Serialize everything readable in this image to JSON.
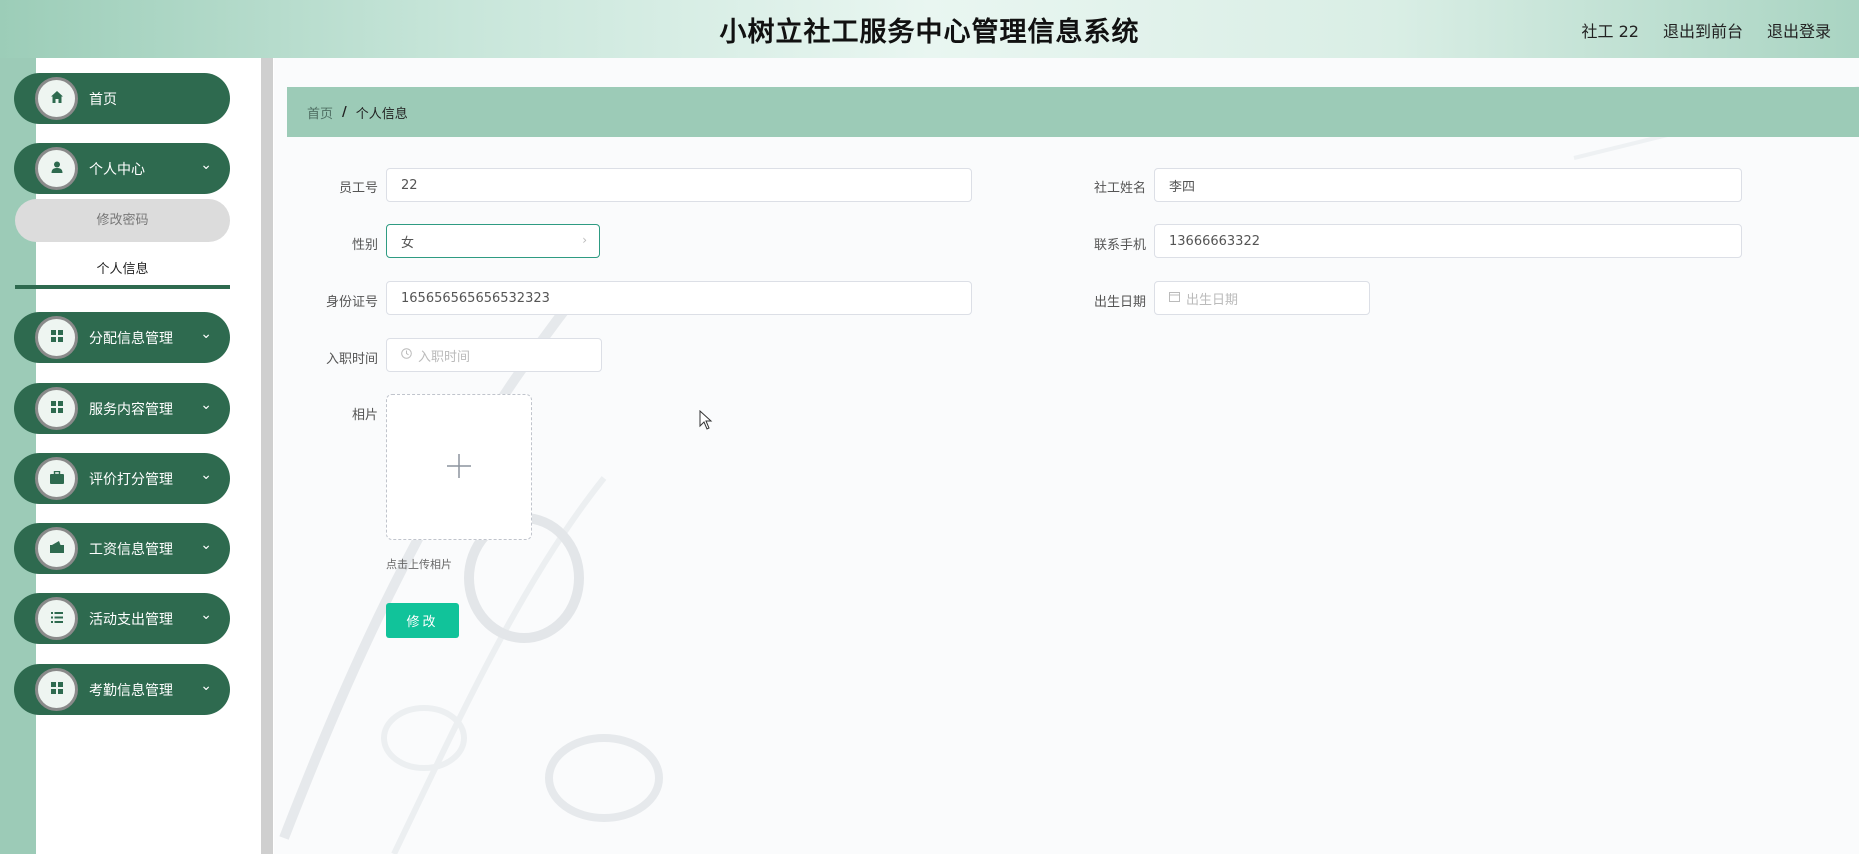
{
  "header": {
    "title": "小树立社工服务中心管理信息系统",
    "user_label": "社工 22",
    "to_front_label": "退出到前台",
    "logout_label": "退出登录"
  },
  "sidebar": {
    "items": [
      {
        "label": "首页",
        "icon": "home-icon",
        "has_children": false
      },
      {
        "label": "个人中心",
        "icon": "user-icon",
        "has_children": true,
        "expanded": true,
        "children": [
          {
            "label": "修改密码",
            "active": false
          },
          {
            "label": "个人信息",
            "active": true
          }
        ]
      },
      {
        "label": "分配信息管理",
        "icon": "grid-icon",
        "has_children": true
      },
      {
        "label": "服务内容管理",
        "icon": "grid-icon",
        "has_children": true
      },
      {
        "label": "评价打分管理",
        "icon": "briefcase-icon",
        "has_children": true
      },
      {
        "label": "工资信息管理",
        "icon": "wallet-icon",
        "has_children": true
      },
      {
        "label": "活动支出管理",
        "icon": "list-icon",
        "has_children": true
      },
      {
        "label": "考勤信息管理",
        "icon": "grid-icon",
        "has_children": true
      }
    ]
  },
  "breadcrumb": {
    "home": "首页",
    "separator": "/",
    "current": "个人信息"
  },
  "form": {
    "employee_no_label": "员工号",
    "employee_no_value": "22",
    "worker_name_label": "社工姓名",
    "worker_name_value": "李四",
    "gender_label": "性别",
    "gender_value": "女",
    "phone_label": "联系手机",
    "phone_value": "13666663322",
    "id_card_label": "身份证号",
    "id_card_value": "165656565656532323",
    "birth_label": "出生日期",
    "birth_placeholder": "出生日期",
    "hire_label": "入职时间",
    "hire_placeholder": "入职时间",
    "photo_label": "相片",
    "photo_tip": "点击上传相片",
    "submit_label": "修改"
  },
  "colors": {
    "menu_bg": "#2e6a4f",
    "breadcrumb_bg": "#9ccbb7",
    "submit_bg": "#11c39a"
  }
}
